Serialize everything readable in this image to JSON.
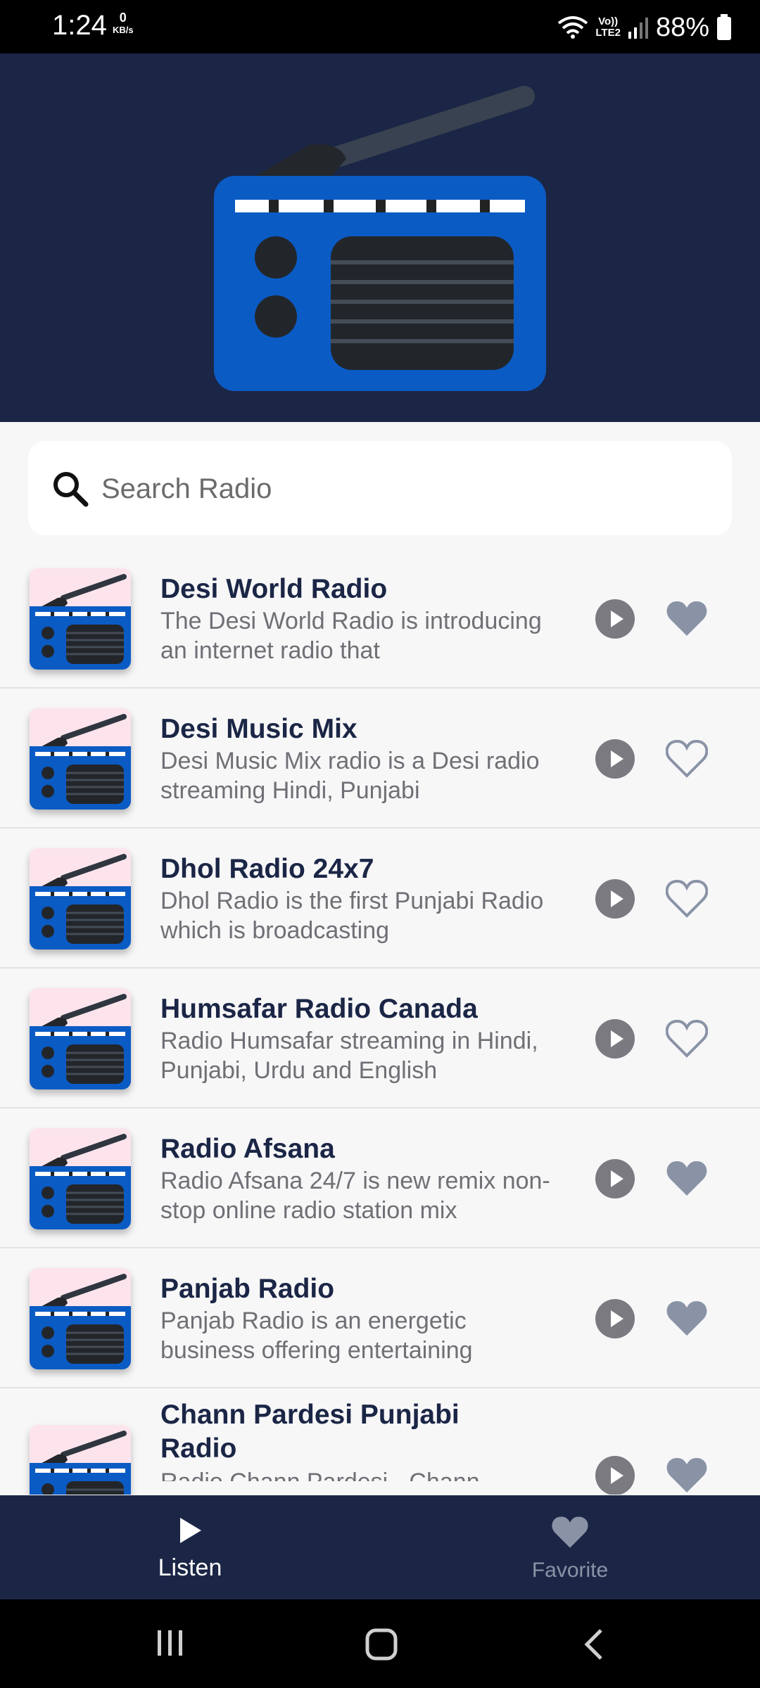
{
  "status_bar": {
    "time": "1:24",
    "net_speed_value": "0",
    "net_speed_unit": "KB/s",
    "volte_line1": "Vo))",
    "volte_line2": "LTE2",
    "battery": "88%"
  },
  "search": {
    "placeholder": "Search Radio",
    "value": ""
  },
  "stations": [
    {
      "title": "Desi World Radio",
      "description": "The Desi World Radio is introducing an internet radio that",
      "favorite": true
    },
    {
      "title": "Desi Music Mix",
      "description": "Desi Music Mix radio is a Desi radio streaming Hindi, Punjabi",
      "favorite": false
    },
    {
      "title": "Dhol Radio 24x7",
      "description": "Dhol Radio is the first Punjabi Radio which is broadcasting",
      "favorite": false
    },
    {
      "title": "Humsafar Radio Canada",
      "description": "Radio Humsafar streaming in Hindi, Punjabi, Urdu and English",
      "favorite": false
    },
    {
      "title": "Radio Afsana",
      "description": "Radio Afsana 24/7 is new remix non-stop online radio station mix",
      "favorite": true
    },
    {
      "title": "Panjab Radio",
      "description": "Panjab Radio is an energetic business offering entertaining",
      "favorite": true
    },
    {
      "title": "Chann Pardesi Punjabi Radio",
      "description": "Radio Chann Pardesi - Chann",
      "favorite": true
    }
  ],
  "bottom_nav": {
    "listen_label": "Listen",
    "favorite_label": "Favorite",
    "active_tab": "Listen"
  },
  "colors": {
    "header_bg": "#1b2646",
    "radio_blue": "#0b5bc4",
    "favorite_filled": "#8a93a6",
    "title_text": "#1b2646"
  }
}
